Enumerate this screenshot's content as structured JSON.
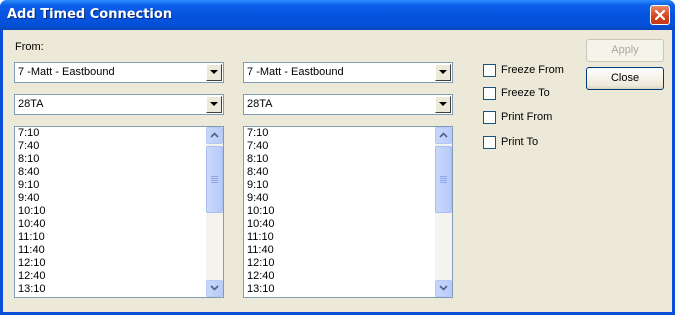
{
  "window": {
    "title": "Add Timed Connection"
  },
  "from_label": "From:",
  "left": {
    "route": "7 -Matt - Eastbound",
    "stop": "28TA",
    "times": [
      "7:10",
      "7:40",
      "8:10",
      "8:40",
      "9:10",
      "9:40",
      "10:10",
      "10:40",
      "11:10",
      "11:40",
      "12:10",
      "12:40",
      "13:10"
    ]
  },
  "right": {
    "route": "7 -Matt - Eastbound",
    "stop": "28TA",
    "times": [
      "7:10",
      "7:40",
      "8:10",
      "8:40",
      "9:10",
      "9:40",
      "10:10",
      "10:40",
      "11:10",
      "11:40",
      "12:10",
      "12:40",
      "13:10"
    ]
  },
  "options": {
    "freeze_from": "Freeze From",
    "freeze_to": "Freeze To",
    "print_from": "Print From",
    "print_to": "Print To"
  },
  "buttons": {
    "apply": "Apply",
    "close": "Close"
  }
}
